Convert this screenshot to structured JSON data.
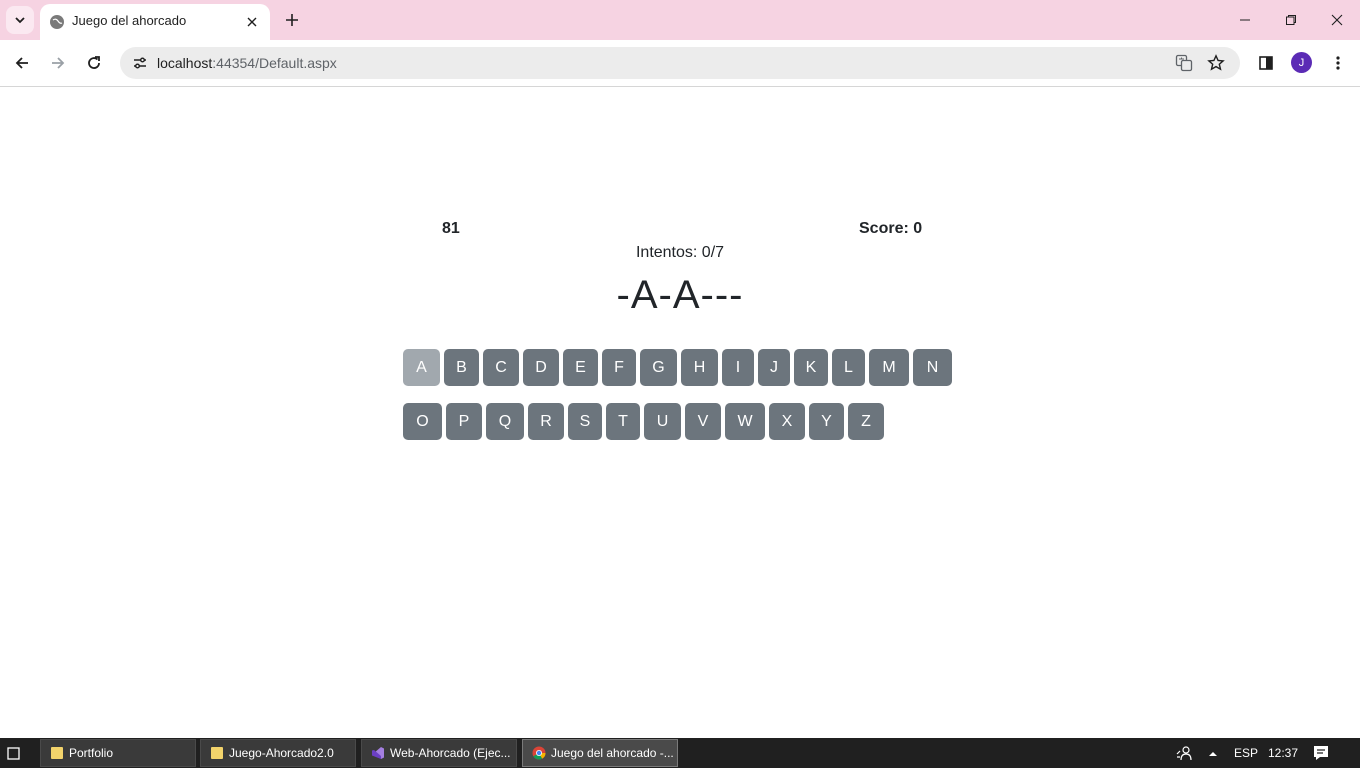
{
  "browser": {
    "tab_title": "Juego del ahorcado",
    "url_host": "localhost",
    "url_rest": ":44354/Default.aspx"
  },
  "profile": {
    "initial": "J"
  },
  "game": {
    "timer": "81",
    "score": "Score: 0",
    "attempts": "Intentos: 0/7",
    "word": "-A-A---",
    "keyboard_row1": [
      "A",
      "B",
      "C",
      "D",
      "E",
      "F",
      "G",
      "H",
      "I",
      "J",
      "K",
      "L",
      "M",
      "N"
    ],
    "keyboard_row2": [
      "O",
      "P",
      "Q",
      "R",
      "S",
      "T",
      "U",
      "V",
      "W",
      "X",
      "Y",
      "Z"
    ],
    "used_letters": [
      "A"
    ]
  },
  "taskbar": {
    "items": [
      {
        "label": "Portfolio",
        "icon": "folder-icon"
      },
      {
        "label": "Juego-Ahorcado2.0",
        "icon": "folder-icon"
      },
      {
        "label": "Web-Ahorcado (Ejec...",
        "icon": "visual-studio-icon"
      },
      {
        "label": "Juego del ahorcado -...",
        "icon": "chrome-icon"
      }
    ],
    "language": "ESP",
    "clock": "12:37"
  },
  "colors": {
    "tabstrip": "#f6d3e2",
    "key": "#6c757d",
    "key_used": "#a1a8ae",
    "avatar": "#5b2bb5"
  }
}
